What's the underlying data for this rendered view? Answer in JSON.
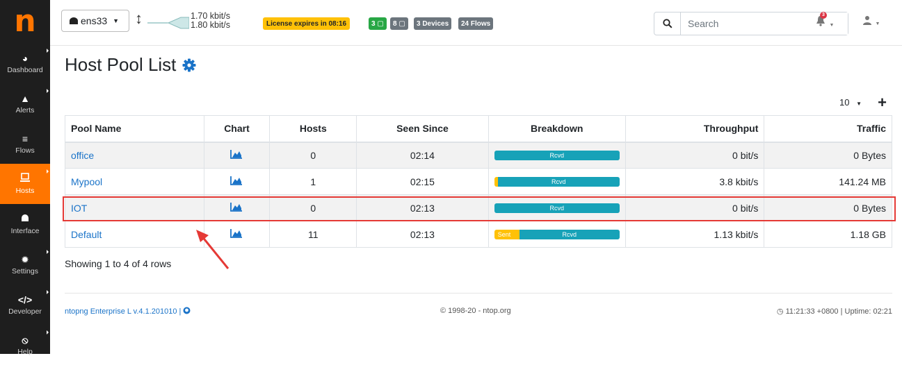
{
  "logo": "n",
  "sidebar": {
    "items": [
      {
        "label": "Dashboard",
        "icon": "tachometer-icon"
      },
      {
        "label": "Alerts",
        "icon": "warning-icon"
      },
      {
        "label": "Flows",
        "icon": "stream-icon"
      },
      {
        "label": "Hosts",
        "icon": "laptop-icon",
        "active": true
      },
      {
        "label": "Interface",
        "icon": "ethernet-icon"
      },
      {
        "label": "Settings",
        "icon": "cog-icon"
      },
      {
        "label": "Developer",
        "icon": "code-icon"
      },
      {
        "label": "Help",
        "icon": "life-ring-icon"
      }
    ]
  },
  "topbar": {
    "interface": "ens33",
    "upload_rate": "1.70 kbit/s",
    "download_rate": "1.80 kbit/s",
    "license": "License expires in 08:16",
    "badges": [
      "3",
      "8",
      "3 Devices",
      "24 Flows"
    ],
    "search_placeholder": "Search",
    "alerts_count": "3"
  },
  "main": {
    "title": "Host Pool List",
    "page_size": "10",
    "columns": [
      "Pool Name",
      "Chart",
      "Hosts",
      "Seen Since",
      "Breakdown",
      "Throughput",
      "Traffic"
    ],
    "rows": [
      {
        "name": "office",
        "hosts": "0",
        "seen": "02:14",
        "sent_label": "",
        "rcvd_label": "Rcvd",
        "sent_pct": 0,
        "throughput": "0 bit/s",
        "traffic": "0 Bytes"
      },
      {
        "name": "Mypool",
        "hosts": "1",
        "seen": "02:15",
        "sent_label": "",
        "rcvd_label": "Rcvd",
        "sent_pct": 2,
        "throughput": "3.8 kbit/s",
        "traffic": "141.24 MB"
      },
      {
        "name": "IOT",
        "hosts": "0",
        "seen": "02:13",
        "sent_label": "",
        "rcvd_label": "Rcvd",
        "sent_pct": 0,
        "throughput": "0 bit/s",
        "traffic": "0 Bytes"
      },
      {
        "name": "Default",
        "hosts": "11",
        "seen": "02:13",
        "sent_label": "Sent",
        "rcvd_label": "Rcvd",
        "sent_pct": 20,
        "throughput": "1.13 kbit/s",
        "traffic": "1.18 GB"
      }
    ],
    "showing": "Showing 1 to 4 of 4 rows"
  },
  "footer": {
    "version": "ntopng Enterprise L v.4.1.201010 |",
    "copyright": "© 1998-20 - ntop.org",
    "uptime": "11:21:33 +0800 | Uptime: 02:21"
  },
  "colors": {
    "accent": "#ff7500",
    "link": "#1a73c8",
    "rcvd": "#17a2b8",
    "sent": "#ffc107",
    "highlight": "#e53935"
  }
}
